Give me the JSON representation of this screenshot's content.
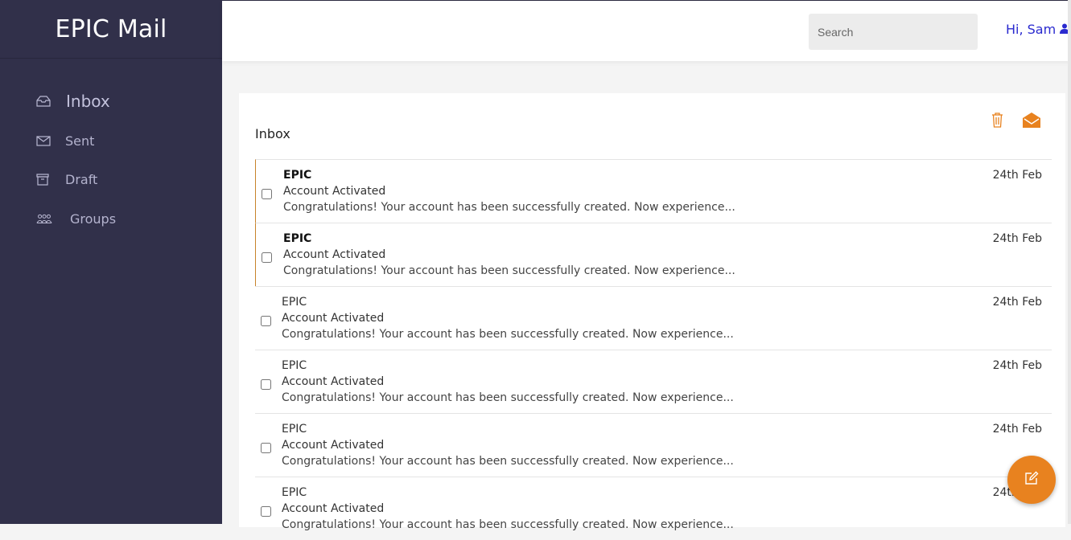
{
  "app": {
    "brand": "EPIC Mail"
  },
  "sidebar": {
    "items": [
      {
        "label": "Inbox",
        "icon": "inbox-icon"
      },
      {
        "label": "Sent",
        "icon": "envelope-icon"
      },
      {
        "label": "Draft",
        "icon": "archive-box-icon"
      },
      {
        "label": "Groups",
        "icon": "users-icon"
      }
    ]
  },
  "header": {
    "search_placeholder": "Search",
    "greeting": "Hi, Sam",
    "user_icon": "user-icon"
  },
  "inbox": {
    "title": "Inbox",
    "actions": [
      "trash-icon",
      "mark-read-envelope-icon"
    ],
    "messages": [
      {
        "sender": "EPIC",
        "subject": "Account Activated",
        "preview": "Congratulations! Your account has been successfully created. Now experience...",
        "date": "24th Feb",
        "unread": true
      },
      {
        "sender": "EPIC",
        "subject": "Account Activated",
        "preview": "Congratulations! Your account has been successfully created. Now experience...",
        "date": "24th Feb",
        "unread": true
      },
      {
        "sender": "EPIC",
        "subject": "Account Activated",
        "preview": "Congratulations! Your account has been successfully created. Now experience...",
        "date": "24th Feb",
        "unread": false
      },
      {
        "sender": "EPIC",
        "subject": "Account Activated",
        "preview": "Congratulations! Your account has been successfully created. Now experience...",
        "date": "24th Feb",
        "unread": false
      },
      {
        "sender": "EPIC",
        "subject": "Account Activated",
        "preview": "Congratulations! Your account has been successfully created. Now experience...",
        "date": "24th Feb",
        "unread": false
      },
      {
        "sender": "EPIC",
        "subject": "Account Activated",
        "preview": "Congratulations! Your account has been successfully created. Now experience...",
        "date": "24th Feb",
        "unread": false
      }
    ]
  },
  "compose": {
    "icon": "compose-icon"
  },
  "colors": {
    "sidebar_bg": "#31304a",
    "accent": "#e8821f",
    "link": "#2a2acf"
  }
}
